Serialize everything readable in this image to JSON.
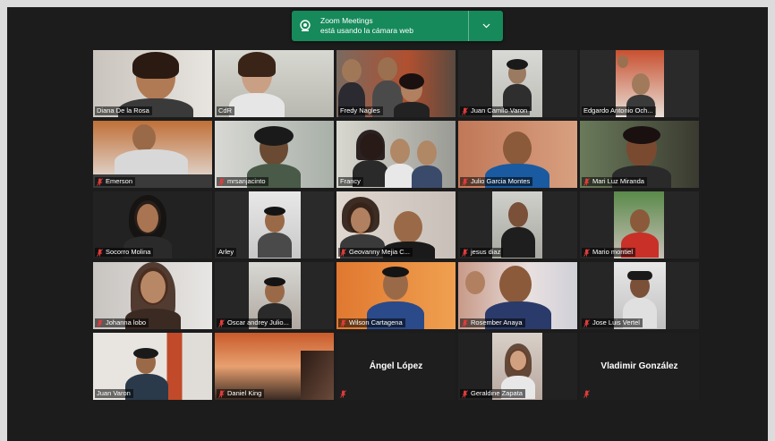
{
  "notification": {
    "title": "Zoom Meetings",
    "message": "está usando la cámara web"
  },
  "participants": [
    {
      "name": "Diana De la Rosa",
      "muted": false
    },
    {
      "name": "CdR",
      "muted": false
    },
    {
      "name": "Fredy Nagles",
      "muted": false
    },
    {
      "name": "Juan Camilo Varon",
      "muted": true
    },
    {
      "name": "Edgardo Antonio Och...",
      "muted": false
    },
    {
      "name": "Emerson",
      "muted": true
    },
    {
      "name": "mrsanjacinto",
      "muted": true
    },
    {
      "name": "Francy",
      "muted": false
    },
    {
      "name": "Julio Garcia Montes",
      "muted": true
    },
    {
      "name": "Mari Luz Miranda",
      "muted": true
    },
    {
      "name": "Socorro Molina",
      "muted": true
    },
    {
      "name": "Arley",
      "muted": false
    },
    {
      "name": "Geovanny Mejia C...",
      "muted": true
    },
    {
      "name": "jesus diaz",
      "muted": true
    },
    {
      "name": "Mario montiel",
      "muted": true
    },
    {
      "name": "Johanna lobo",
      "muted": true
    },
    {
      "name": "Oscar andrey Julio...",
      "muted": true
    },
    {
      "name": "Wilson Cartagena",
      "muted": true
    },
    {
      "name": "Rosember Anaya",
      "muted": true
    },
    {
      "name": "Jose Luis Vertel",
      "muted": true
    },
    {
      "name": "Juan Varon",
      "muted": false
    },
    {
      "name": "Daniel King",
      "muted": true
    },
    {
      "name": "",
      "muted": true,
      "display_name": "Ángel López"
    },
    {
      "name": "Geraldine Zapata",
      "muted": true
    },
    {
      "name": "",
      "muted": true,
      "display_name": "Vladimir González"
    }
  ]
}
